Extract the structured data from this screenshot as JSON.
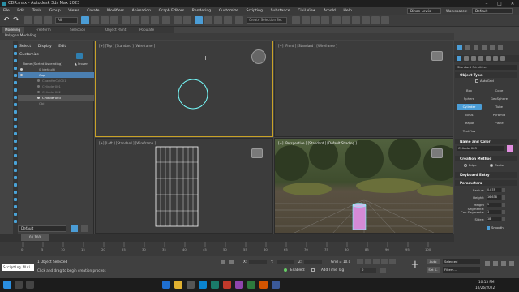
{
  "window": {
    "title": "CDR.max - Autodesk 3ds Max 2023",
    "min": "–",
    "max": "□",
    "close": "✕"
  },
  "menu": [
    "File",
    "Edit",
    "Tools",
    "Group",
    "Views",
    "Create",
    "Modifiers",
    "Animation",
    "Graph Editors",
    "Rendering",
    "Customize",
    "Scripting",
    "Substance",
    "Civil View",
    "Arnold",
    "Help"
  ],
  "account": {
    "user": "Dinan Lewis",
    "workspace_label": "Workspaces:",
    "workspace": "Default"
  },
  "toolbar": {
    "filter": "All",
    "selection_set": "Create Selection Set"
  },
  "ribbon": {
    "tabs": [
      "Modeling",
      "Freeform",
      "Selection",
      "Object Paint",
      "Populate"
    ],
    "panel": "Polygon Modeling"
  },
  "explorer": {
    "menu": [
      "Select",
      "Display",
      "Edit",
      "Customize"
    ],
    "header": "Name (Sorted Ascending)",
    "frozen_header": "▲ Frozen",
    "rows": [
      {
        "label": "0 (default)",
        "type": "layer"
      },
      {
        "label": "Cap",
        "type": "selected"
      },
      {
        "label": "ChamferCyl001",
        "type": "sub"
      },
      {
        "label": "Cylinder001",
        "type": "sub"
      },
      {
        "label": "Cylinder002",
        "type": "sub"
      },
      {
        "label": "Cylinder003",
        "type": "sub-bold"
      },
      {
        "label": "Obj",
        "type": "layer"
      }
    ],
    "layer_dropdown": "Default"
  },
  "viewports": {
    "top": "[+] [Top ] [Standard ] [Wireframe ]",
    "front": "[+] [Front ] [Standard ] [Wireframe ]",
    "left": "[+] [Left ] [Standard ] [Wireframe ]",
    "perspective": "[+] [Perspective ] [Standard ] [Default Shading ]"
  },
  "command_panel": {
    "standard_dropdown": "Standard Primitives",
    "object_type": "Object Type",
    "autogrid": "AutoGrid",
    "buttons": [
      "Box",
      "Cone",
      "Sphere",
      "GeoSphere",
      "Cylinder",
      "Tube",
      "Torus",
      "Pyramid",
      "Teapot",
      "Plane",
      "TextPlus"
    ],
    "active_button": "Cylinder",
    "name_color": "Name and Color",
    "object_name": "Cylinder003",
    "creation_method": "Creation Method",
    "edge": "Edge",
    "center": "Center",
    "keyboard_entry": "Keyboard Entry",
    "parameters": "Parameters",
    "params": [
      {
        "label": "Radius:",
        "value": "0.878"
      },
      {
        "label": "Height:",
        "value": "16.638"
      },
      {
        "label": "Height Segments:",
        "value": "5"
      },
      {
        "label": "Cap Segments:",
        "value": "1"
      },
      {
        "label": "Sides:",
        "value": "18"
      }
    ],
    "smooth": "Smooth",
    "accent": "#4b9dd6",
    "swatch": "#e28ee0"
  },
  "timeline": {
    "frame": "0 / 100",
    "ticks": [
      "0",
      "5",
      "10",
      "15",
      "20",
      "25",
      "30",
      "35",
      "40",
      "45",
      "50",
      "55",
      "60",
      "65",
      "70",
      "75",
      "80",
      "85",
      "90",
      "95",
      "100"
    ]
  },
  "status": {
    "script": "Scripting Mini",
    "selected": "1 Object Selected",
    "prompt": "Click and drag to begin creation process",
    "x": "X:",
    "y": "Y:",
    "z": "Z:",
    "grid": "Grid = 10.0",
    "enabled": "Enabled:",
    "add_time_tag": "Add Time Tag",
    "auto": "Auto",
    "set_k": "Set K.",
    "selected_dd": "Selected",
    "filters": "Filters...",
    "frame_box": "0"
  },
  "taskbar": {
    "time": "10:13 PM",
    "date": "10/26/2022"
  }
}
